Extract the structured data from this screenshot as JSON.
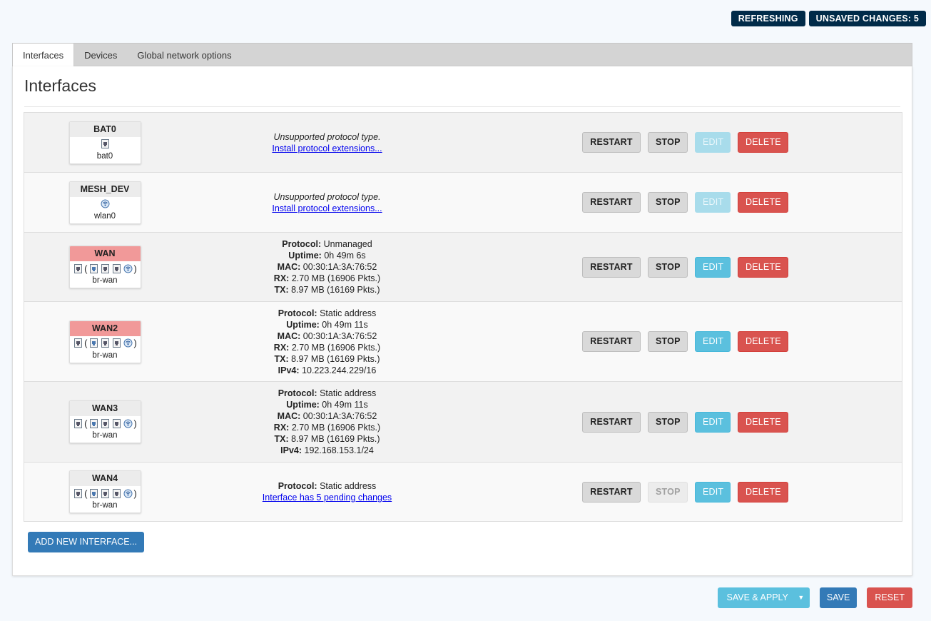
{
  "indicators": {
    "refreshing": "REFRESHING",
    "unsaved": "UNSAVED CHANGES: 5"
  },
  "tabs": [
    {
      "label": "Interfaces"
    },
    {
      "label": "Devices"
    },
    {
      "label": "Global network options"
    }
  ],
  "page": {
    "title": "Interfaces"
  },
  "interfaces": [
    {
      "name": "BAT0",
      "device": "bat0",
      "unsupported": "Unsupported protocol type.",
      "link": "Install protocol extensions...",
      "buttons": {
        "restart": "RESTART",
        "stop": "STOP",
        "edit": "EDIT",
        "delete": "DELETE"
      }
    },
    {
      "name": "MESH_DEV",
      "device": "wlan0",
      "unsupported": "Unsupported protocol type.",
      "link": "Install protocol extensions...",
      "buttons": {
        "restart": "RESTART",
        "stop": "STOP",
        "edit": "EDIT",
        "delete": "DELETE"
      }
    },
    {
      "name": "WAN",
      "device": "br-wan",
      "status": {
        "protocol_label": "Protocol:",
        "protocol": "Unmanaged",
        "uptime_label": "Uptime:",
        "uptime": "0h 49m 6s",
        "mac_label": "MAC:",
        "mac": "00:30:1A:3A:76:52",
        "rx_label": "RX:",
        "rx": "2.70 MB (16906 Pkts.)",
        "tx_label": "TX:",
        "tx": "8.97 MB (16169 Pkts.)"
      },
      "buttons": {
        "restart": "RESTART",
        "stop": "STOP",
        "edit": "EDIT",
        "delete": "DELETE"
      }
    },
    {
      "name": "WAN2",
      "device": "br-wan",
      "status": {
        "protocol_label": "Protocol:",
        "protocol": "Static address",
        "uptime_label": "Uptime:",
        "uptime": "0h 49m 11s",
        "mac_label": "MAC:",
        "mac": "00:30:1A:3A:76:52",
        "rx_label": "RX:",
        "rx": "2.70 MB (16906 Pkts.)",
        "tx_label": "TX:",
        "tx": "8.97 MB (16169 Pkts.)",
        "ipv4_label": "IPv4:",
        "ipv4": "10.223.244.229/16"
      },
      "buttons": {
        "restart": "RESTART",
        "stop": "STOP",
        "edit": "EDIT",
        "delete": "DELETE"
      }
    },
    {
      "name": "WAN3",
      "device": "br-wan",
      "status": {
        "protocol_label": "Protocol:",
        "protocol": "Static address",
        "uptime_label": "Uptime:",
        "uptime": "0h 49m 11s",
        "mac_label": "MAC:",
        "mac": "00:30:1A:3A:76:52",
        "rx_label": "RX:",
        "rx": "2.70 MB (16906 Pkts.)",
        "tx_label": "TX:",
        "tx": "8.97 MB (16169 Pkts.)",
        "ipv4_label": "IPv4:",
        "ipv4": "192.168.153.1/24"
      },
      "buttons": {
        "restart": "RESTART",
        "stop": "STOP",
        "edit": "EDIT",
        "delete": "DELETE"
      }
    },
    {
      "name": "WAN4",
      "device": "br-wan",
      "status": {
        "protocol_label": "Protocol:",
        "protocol": "Static address"
      },
      "pending_link": "Interface has 5 pending changes",
      "buttons": {
        "restart": "RESTART",
        "stop": "STOP",
        "edit": "EDIT",
        "delete": "DELETE"
      }
    }
  ],
  "add_button": "ADD NEW INTERFACE...",
  "footer": {
    "save_apply": "SAVE & APPLY",
    "save": "SAVE",
    "reset": "RESET"
  },
  "colors": {
    "indicator_bg": "#002b49",
    "edit": "#5bc0de",
    "delete": "#d9534f",
    "primary": "#337ab7",
    "down_badge": "#f19999"
  },
  "icons": [
    "ethernet-port-icon",
    "bridge-icon",
    "wifi-icon"
  ]
}
